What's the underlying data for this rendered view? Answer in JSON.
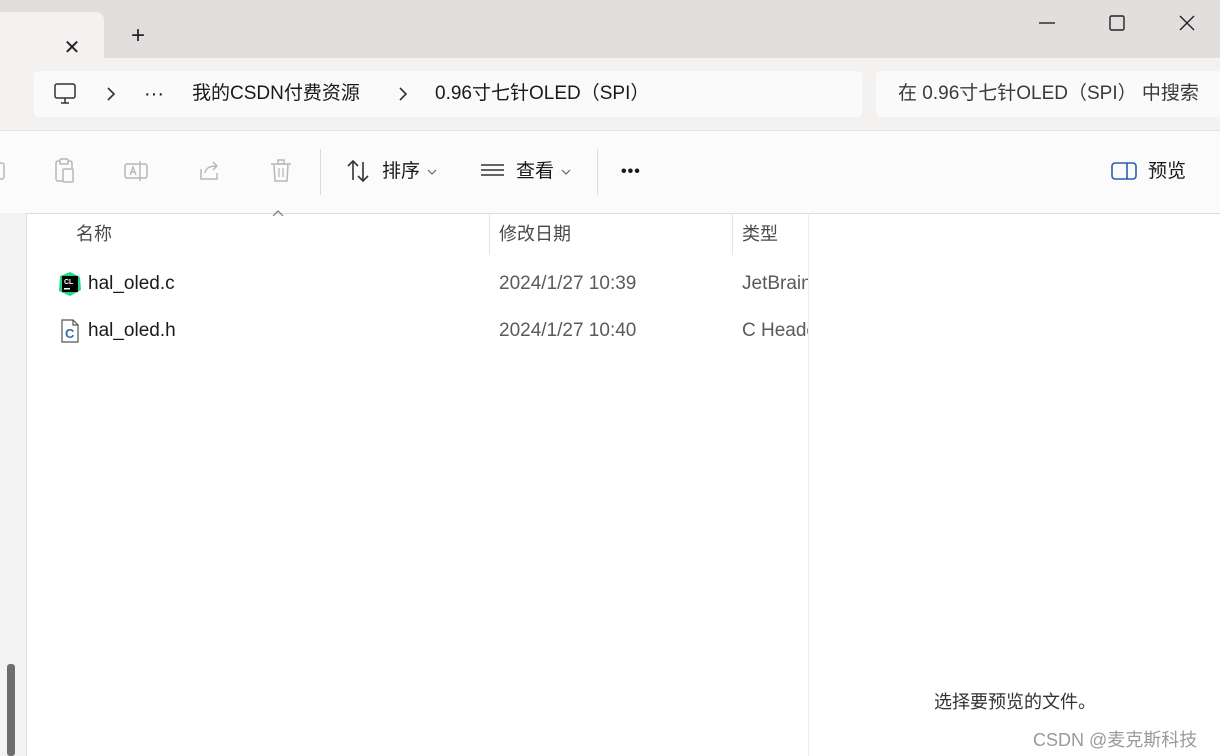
{
  "window": {
    "tab_close": "✕",
    "tab_new": "+"
  },
  "address": {
    "ellipsis": "···",
    "crumbs": [
      "我的CSDN付费资源",
      "0.96寸七针OLED（SPI）"
    ],
    "search_placeholder": "在 0.96寸七针OLED（SPI） 中搜索"
  },
  "toolbar": {
    "sort_label": "排序",
    "view_label": "查看",
    "more_label": "•••",
    "preview_label": "预览"
  },
  "columns": {
    "name": "名称",
    "modified": "修改日期",
    "type": "类型"
  },
  "files": [
    {
      "name": "hal_oled.c",
      "modified": "2024/1/27 10:39",
      "type": "JetBrains CLion",
      "icon": "clion-file-icon"
    },
    {
      "name": "hal_oled.h",
      "modified": "2024/1/27 10:40",
      "type": "C Header File",
      "icon": "c-header-file-icon"
    }
  ],
  "preview": {
    "message": "选择要预览的文件。"
  },
  "watermark": "CSDN @麦克斯科技",
  "colors": {
    "titlebar": "#e3dede",
    "address_row": "#f4f1f1",
    "clion_green": "#21d789"
  }
}
